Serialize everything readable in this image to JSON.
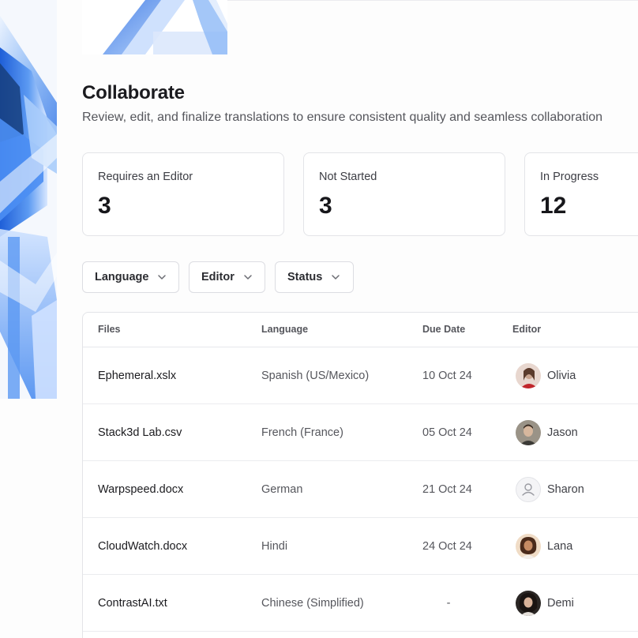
{
  "header": {
    "title": "Collaborate",
    "subtitle": "Review, edit, and finalize translations to ensure consistent quality and seamless collaboration"
  },
  "stats": [
    {
      "label": "Requires an Editor",
      "value": "3"
    },
    {
      "label": "Not Started",
      "value": "3"
    },
    {
      "label": "In Progress",
      "value": "12"
    }
  ],
  "filters": {
    "language": "Language",
    "editor": "Editor",
    "status": "Status"
  },
  "table": {
    "columns": [
      "Files",
      "Language",
      "Due Date",
      "Editor"
    ],
    "rows": [
      {
        "file": "Ephemeral.xslx",
        "language": "Spanish (US/Mexico)",
        "due": "10 Oct 24",
        "editor": "Olivia",
        "avatar": "photo-avatar"
      },
      {
        "file": "Stack3d Lab.csv",
        "language": "French (France)",
        "due": "05 Oct 24",
        "editor": "Jason",
        "avatar": "photo-avatar"
      },
      {
        "file": "Warpspeed.docx",
        "language": "German",
        "due": "21 Oct 24",
        "editor": "Sharon",
        "avatar": "user-placeholder-icon"
      },
      {
        "file": "CloudWatch.docx",
        "language": "Hindi",
        "due": "24 Oct 24",
        "editor": "Lana",
        "avatar": "photo-avatar"
      },
      {
        "file": "ContrastAI.txt",
        "language": "Chinese (Simplified)",
        "due": "-",
        "editor": "Demi",
        "avatar": "photo-avatar"
      }
    ]
  },
  "colors": {
    "accent_blue": "#3d86f0",
    "border": "#e3e4e8",
    "text_primary": "#1b1b1f",
    "text_secondary": "#55565c"
  }
}
